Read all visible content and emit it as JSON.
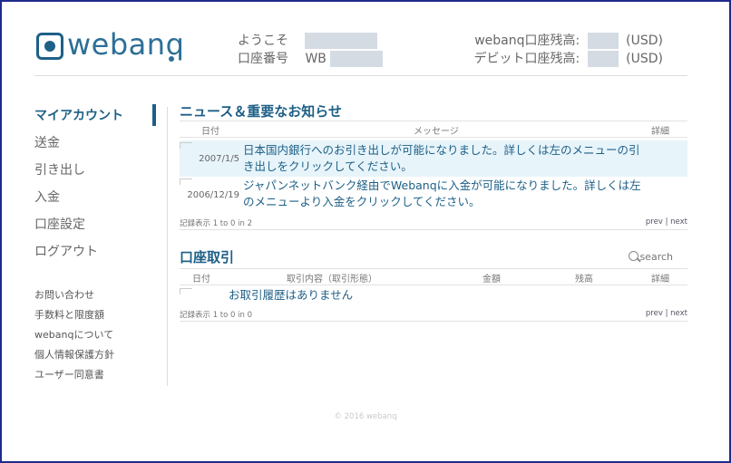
{
  "brand": {
    "logo_text": "webanq"
  },
  "header": {
    "welcome_label": "ようこそ",
    "account_label": "口座番号",
    "account_prefix": "WB",
    "webanq_balance_label": "webanq口座残高:",
    "debit_balance_label": "デビット口座残高:",
    "currency": "(USD)"
  },
  "sidebar": {
    "items": [
      {
        "label": "マイアカウント",
        "active": true
      },
      {
        "label": "送金"
      },
      {
        "label": "引き出し"
      },
      {
        "label": "入金"
      },
      {
        "label": "口座設定"
      },
      {
        "label": "ログアウト"
      }
    ],
    "sub_items": [
      {
        "label": "お問い合わせ"
      },
      {
        "label": "手数料と限度額"
      },
      {
        "label": "webanqについて"
      },
      {
        "label": "個人情報保護方針"
      },
      {
        "label": "ユーザー同意書"
      }
    ]
  },
  "news": {
    "title": "ニュース＆重要なお知らせ",
    "columns": [
      "日付",
      "メッセージ",
      "詳細"
    ],
    "rows": [
      {
        "date": "2007/1/5",
        "message": "日本国内銀行へのお引き出しが可能になりました。詳しくは左のメニューの引き出しをクリックしてください。"
      },
      {
        "date": "2006/12/19",
        "message": "ジャパンネットバンク経由でWebanqに入金が可能になりました。詳しくは左のメニューより入金をクリックしてください。"
      }
    ],
    "record_info": "記録表示 1 to 0 in 2",
    "prev": "prev",
    "sep": "|",
    "next": "next"
  },
  "transactions": {
    "title": "口座取引",
    "search": "search",
    "columns": [
      "日付",
      "取引内容（取引形態）",
      "金額",
      "残高",
      "詳細"
    ],
    "empty_message": "お取引履歴はありません",
    "record_info": "記録表示 1 to 0 in 0",
    "prev": "prev",
    "sep": "|",
    "next": "next"
  },
  "footer": {
    "copyright": "© 2016 webanq"
  },
  "colors": {
    "accent": "#1d5f86",
    "highlight": "#e7f4fa",
    "frame": "#1f2a8c"
  }
}
